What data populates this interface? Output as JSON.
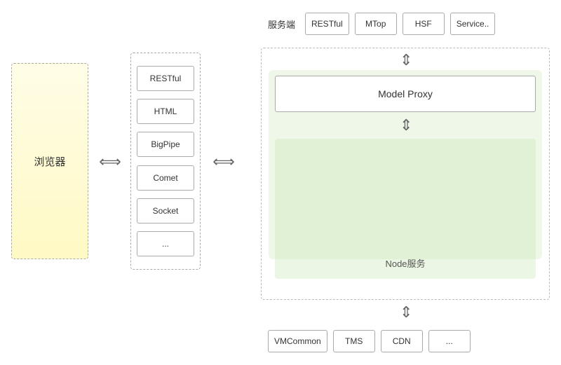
{
  "browser": {
    "label": "浏览器"
  },
  "middle_protocols": {
    "items": [
      "RESTful",
      "HTML",
      "BigPipe",
      "Comet",
      "Socket",
      "..."
    ]
  },
  "top_services": {
    "label": "服务端",
    "items": [
      "RESTful",
      "MTop",
      "HSF",
      "Service.."
    ]
  },
  "main_components": {
    "model_proxy": "Model Proxy",
    "node_service": "Node服务"
  },
  "bottom_services": {
    "items": [
      "VMCommon",
      "TMS",
      "CDN",
      "..."
    ]
  },
  "arrows": {
    "horizontal": "⟺",
    "vertical_up_down": "⇕"
  }
}
